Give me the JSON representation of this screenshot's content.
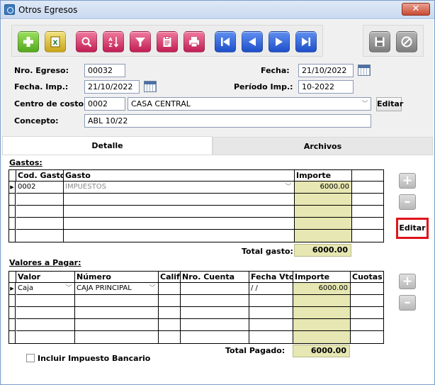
{
  "window": {
    "title": "Otros Egresos",
    "close_label": "✕"
  },
  "form": {
    "nro_egreso_label": "Nro. Egreso:",
    "nro_egreso": "00032",
    "fecha_label": "Fecha:",
    "fecha": "21/10/2022",
    "fecha_imp_label": "Fecha. Imp.:",
    "fecha_imp": "21/10/2022",
    "periodo_label": "Período Imp.:",
    "periodo": "10-2022",
    "centro_label": "Centro de costo:",
    "centro_code": "0002",
    "centro_name": "CASA CENTRAL",
    "editar_label": "Editar",
    "concepto_label": "Concepto:",
    "concepto": "ABL 10/22"
  },
  "tabs": [
    {
      "label": "Detalle"
    },
    {
      "label": "Archivos"
    }
  ],
  "gastos": {
    "title": "Gastos:",
    "columns": [
      "Cod. Gasto",
      "Gasto",
      "Importe"
    ],
    "rows": [
      {
        "cod": "0002",
        "gasto": "IMPUESTOS",
        "importe": "6000.00"
      }
    ],
    "total_label": "Total gasto:",
    "total": "6000.00",
    "editar_label": "Editar"
  },
  "valores": {
    "title": "Valores a Pagar:",
    "columns": [
      "Valor",
      "Número",
      "Calif.",
      "Nro. Cuenta",
      "Fecha Vto.",
      "Importe",
      "Cuotas"
    ],
    "rows": [
      {
        "valor": "Caja",
        "numero": "CAJA PRINCIPAL",
        "calif": "",
        "cuenta": "",
        "fecha": " /  /",
        "importe": "6000.00",
        "cuotas": ""
      }
    ],
    "total_label": "Total Pagado:",
    "total": "6000.00"
  },
  "impuesto_bancario_label": "Incluir Impuesto Bancario",
  "colors": {
    "accent_red": "#e0151b",
    "amount_bg": "#e6e7b2"
  }
}
